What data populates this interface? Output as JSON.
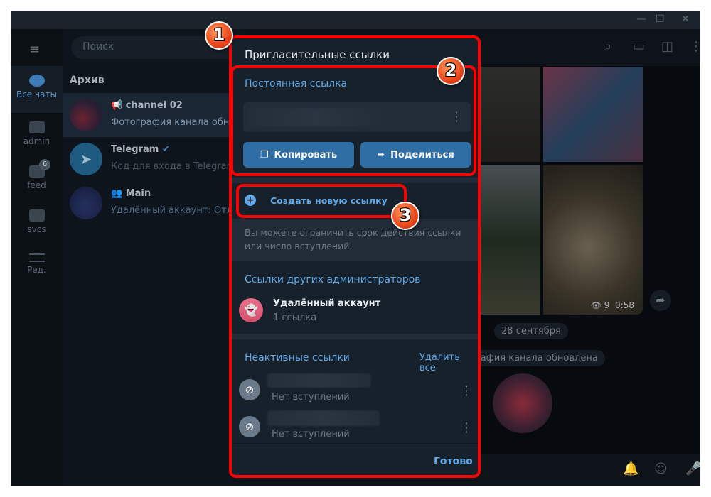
{
  "window": {
    "minimize": "—",
    "maximize": "☐",
    "close": "✕"
  },
  "rail": {
    "items": [
      {
        "label": "Все чаты",
        "icon": "chats-icon"
      },
      {
        "label": "admin",
        "icon": "folder-icon"
      },
      {
        "label": "feed",
        "icon": "folder-icon",
        "badge": "6"
      },
      {
        "label": "svcs",
        "icon": "folder-icon"
      },
      {
        "label": "Ред.",
        "icon": "edit-folders-icon"
      }
    ]
  },
  "chatlist": {
    "search_placeholder": "Поиск",
    "archive": "Архив",
    "chats": [
      {
        "name": "channel 02",
        "preview": "Фотография канала обновлена"
      },
      {
        "name": "Telegram",
        "preview": "Код для входа в Telegram:"
      },
      {
        "name": "Main",
        "preview": "Удалённый аккаунт: Отложено"
      }
    ]
  },
  "main": {
    "views": "9",
    "duration": "0:58",
    "date_pill": "28 сентября",
    "service_pill": "Фотография канала обновлена"
  },
  "dialog": {
    "title": "Пригласительные ссылки",
    "permanent_label": "Постоянная ссылка",
    "copy": "Копировать",
    "share": "Поделиться",
    "create": "Создать новую ссылку",
    "note": "Вы можете ограничить срок действия ссылки или число вступлений.",
    "other_admins": "Ссылки других администраторов",
    "admin": {
      "name": "Удалённый аккаунт",
      "count": "1 ссылка"
    },
    "inactive_label": "Неактивные ссылки",
    "delete_all": "Удалить все",
    "inactive": [
      {
        "status": "Нет вступлений"
      },
      {
        "status": "Нет вступлений"
      }
    ],
    "done": "Готово"
  },
  "annotations": [
    "1",
    "2",
    "3"
  ],
  "colors": {
    "accent": "#5fa8e8",
    "button": "#2f6ea5",
    "highlight": "#ff0000",
    "dialog_bg": "#17212b"
  }
}
